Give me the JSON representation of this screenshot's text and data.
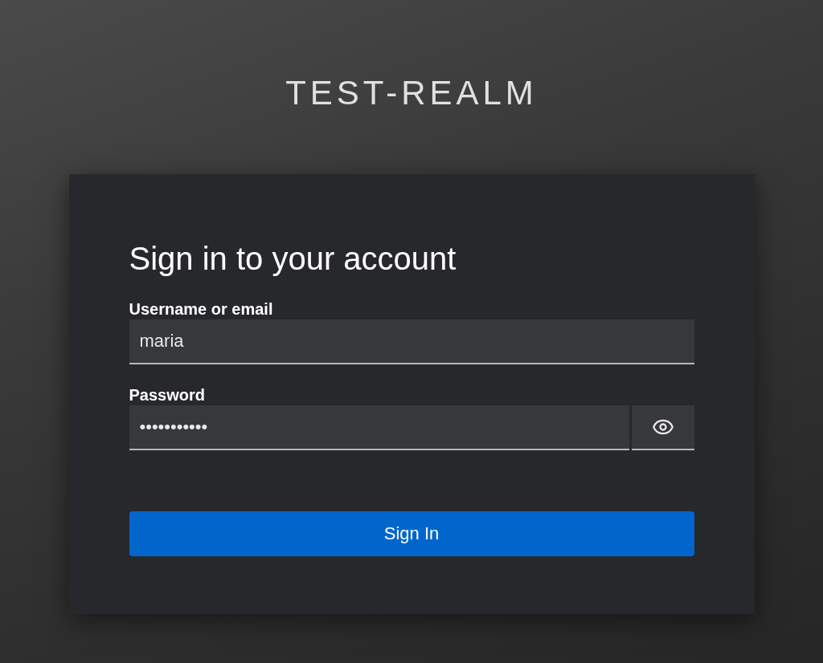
{
  "realm_title": "TEST-REALM",
  "card": {
    "heading": "Sign in to your account",
    "fields": [
      {
        "kind": "text",
        "label": "Username or email",
        "value": "maria"
      },
      {
        "kind": "password",
        "label": "Password",
        "value": "•••••••••••"
      }
    ],
    "submit": "Sign In"
  }
}
